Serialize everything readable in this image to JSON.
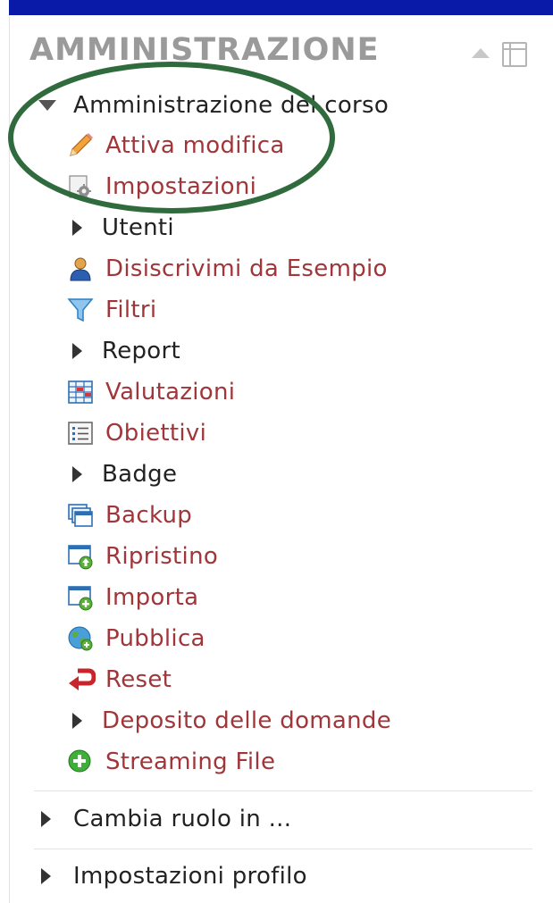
{
  "block": {
    "title": "AMMINISTRAZIONE"
  },
  "course_admin": {
    "heading": "Amministrazione del corso",
    "items": [
      {
        "label": "Attiva modifica",
        "icon": "pencil-icon",
        "link": true
      },
      {
        "label": "Impostazioni",
        "icon": "settings-document-icon",
        "link": true
      },
      {
        "label": "Utenti",
        "icon": "expand-arrow-icon",
        "link": false
      },
      {
        "label": "Disiscrivimi da Esempio",
        "icon": "user-icon",
        "link": true
      },
      {
        "label": "Filtri",
        "icon": "funnel-icon",
        "link": true
      },
      {
        "label": "Report",
        "icon": "expand-arrow-icon",
        "link": false
      },
      {
        "label": "Valutazioni",
        "icon": "gradebook-icon",
        "link": true
      },
      {
        "label": "Obiettivi",
        "icon": "outcomes-list-icon",
        "link": true
      },
      {
        "label": "Badge",
        "icon": "expand-arrow-icon",
        "link": false
      },
      {
        "label": "Backup",
        "icon": "backup-icon",
        "link": true
      },
      {
        "label": "Ripristino",
        "icon": "restore-icon",
        "link": true
      },
      {
        "label": "Importa",
        "icon": "import-icon",
        "link": true
      },
      {
        "label": "Pubblica",
        "icon": "globe-icon",
        "link": true
      },
      {
        "label": "Reset",
        "icon": "reset-arrow-icon",
        "link": true
      },
      {
        "label": "Deposito delle domande",
        "icon": "expand-arrow-icon",
        "link": true
      },
      {
        "label": "Streaming File",
        "icon": "green-plus-icon",
        "link": true
      }
    ]
  },
  "bottom": {
    "switch_role": "Cambia ruolo in ...",
    "profile_settings": "Impostazioni profilo"
  },
  "colors": {
    "link": "#a1363a",
    "text": "#222222",
    "title": "#9a9a9a",
    "top_bar": "#0a1aa8",
    "annotation": "#2f6b3c"
  }
}
